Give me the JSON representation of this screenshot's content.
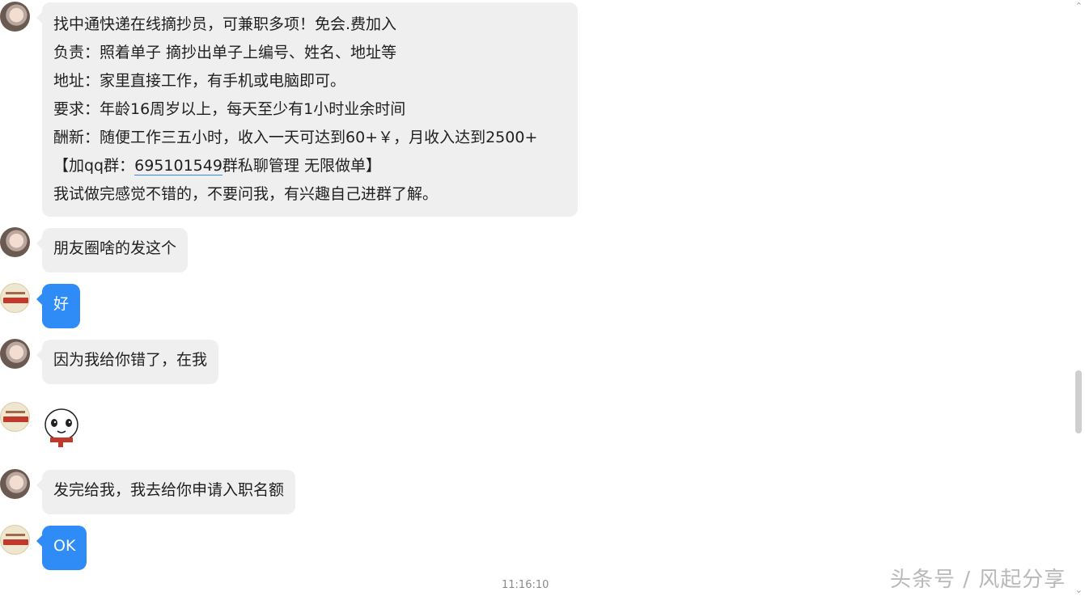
{
  "messages": [
    {
      "sender": "contact",
      "lines": [
        "找中通快递在线摘抄员，可兼职多项！免会.费加入",
        "负责：照着单子 摘抄出单子上编号、姓名、地址等",
        "地址：家里直接工作，有手机或电脑即可。",
        "要求：年龄16周岁以上，每天至少有1小时业余时间",
        "酬新：随便工作三五小时，收入一天可达到60+￥，月收入达到2500+"
      ],
      "line6_prefix": "【加qq群：",
      "line6_link": "695101549",
      "line6_suffix": "群私聊管理 无限做单】",
      "line7": "我试做完感觉不错的，不要问我，有兴趣自己进群了解。"
    },
    {
      "sender": "contact",
      "text": "朋友圈啥的发这个"
    },
    {
      "sender": "me",
      "text": "好"
    },
    {
      "sender": "contact",
      "text": "因为我给你错了，在我"
    },
    {
      "sender": "me",
      "sticker": "panda-face-sticker"
    },
    {
      "sender": "contact",
      "text": "发完给我，我去给你申请入职名额"
    },
    {
      "sender": "me",
      "text": "OK"
    }
  ],
  "timestamp": "11:16:10",
  "watermark": "头条号 / 风起分享",
  "colors": {
    "incoming_bubble": "#efefef",
    "outgoing_bubble": "#2f8cf7"
  }
}
